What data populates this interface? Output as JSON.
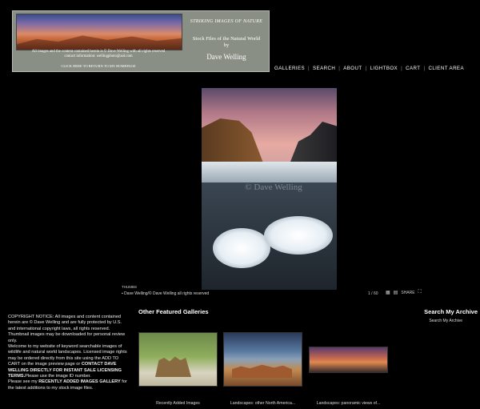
{
  "banner": {
    "title": "STRIKING IMAGES OF NATURE",
    "subtitle_line1": "Stock Files of the Natural World",
    "subtitle_line2": "by",
    "author": "Dave Welling",
    "notice_line1": "All images and the content contained herein is © Dave Welling with all rights reserved",
    "notice_line2": "contact information: wellingphoto@aol.com",
    "homepage_link": "CLICK HERE TO RETURN TO MY HOMEPAGE"
  },
  "nav": {
    "items": [
      "GALLERIES",
      "SEARCH",
      "ABOUT",
      "LIGHTBOX",
      "CART",
      "CLIENT AREA"
    ]
  },
  "viewer": {
    "watermark": "© Dave Welling",
    "thumbs_label": "THUMBS",
    "caption": "Dave Welling/© Dave Welling all rights reserved",
    "pager": "1 / 60",
    "share_label": "SHARE"
  },
  "notice": {
    "p1": "COPYRIGHT NOTICE: All images and content contained herein are © Dave Welling and are fully protected by U.S. and international copyright laws, all rights reserved. Thumbnail images may be downloaded for personal review only.",
    "p2": "Welcome to my website of keyword searchable images of wildlife and natural world landscapes. Licensed image rights may be ordered directly from this site using the ADD TO CART on the image preview page or",
    "p2_bold": "CONTACT DAVE WELLING DIRECTLY FOR INSTANT SALE LICENSING TERMS.",
    "p2_tail": "Please use the image ID number.",
    "p3": "Please see my",
    "p3_bold": "RECENTLY ADDED IMAGES GALLERY",
    "p3_tail": "for the latest additions to my stock image files."
  },
  "featured": {
    "title": "Other Featured Galleries",
    "galleries": [
      {
        "caption": "Recently Added Images"
      },
      {
        "caption": "Landscapes: other North America..."
      },
      {
        "caption": "Landscapes: panoramic views of..."
      }
    ]
  },
  "search_archive": {
    "title": "Search My Archive",
    "link": "Search My Archive"
  }
}
